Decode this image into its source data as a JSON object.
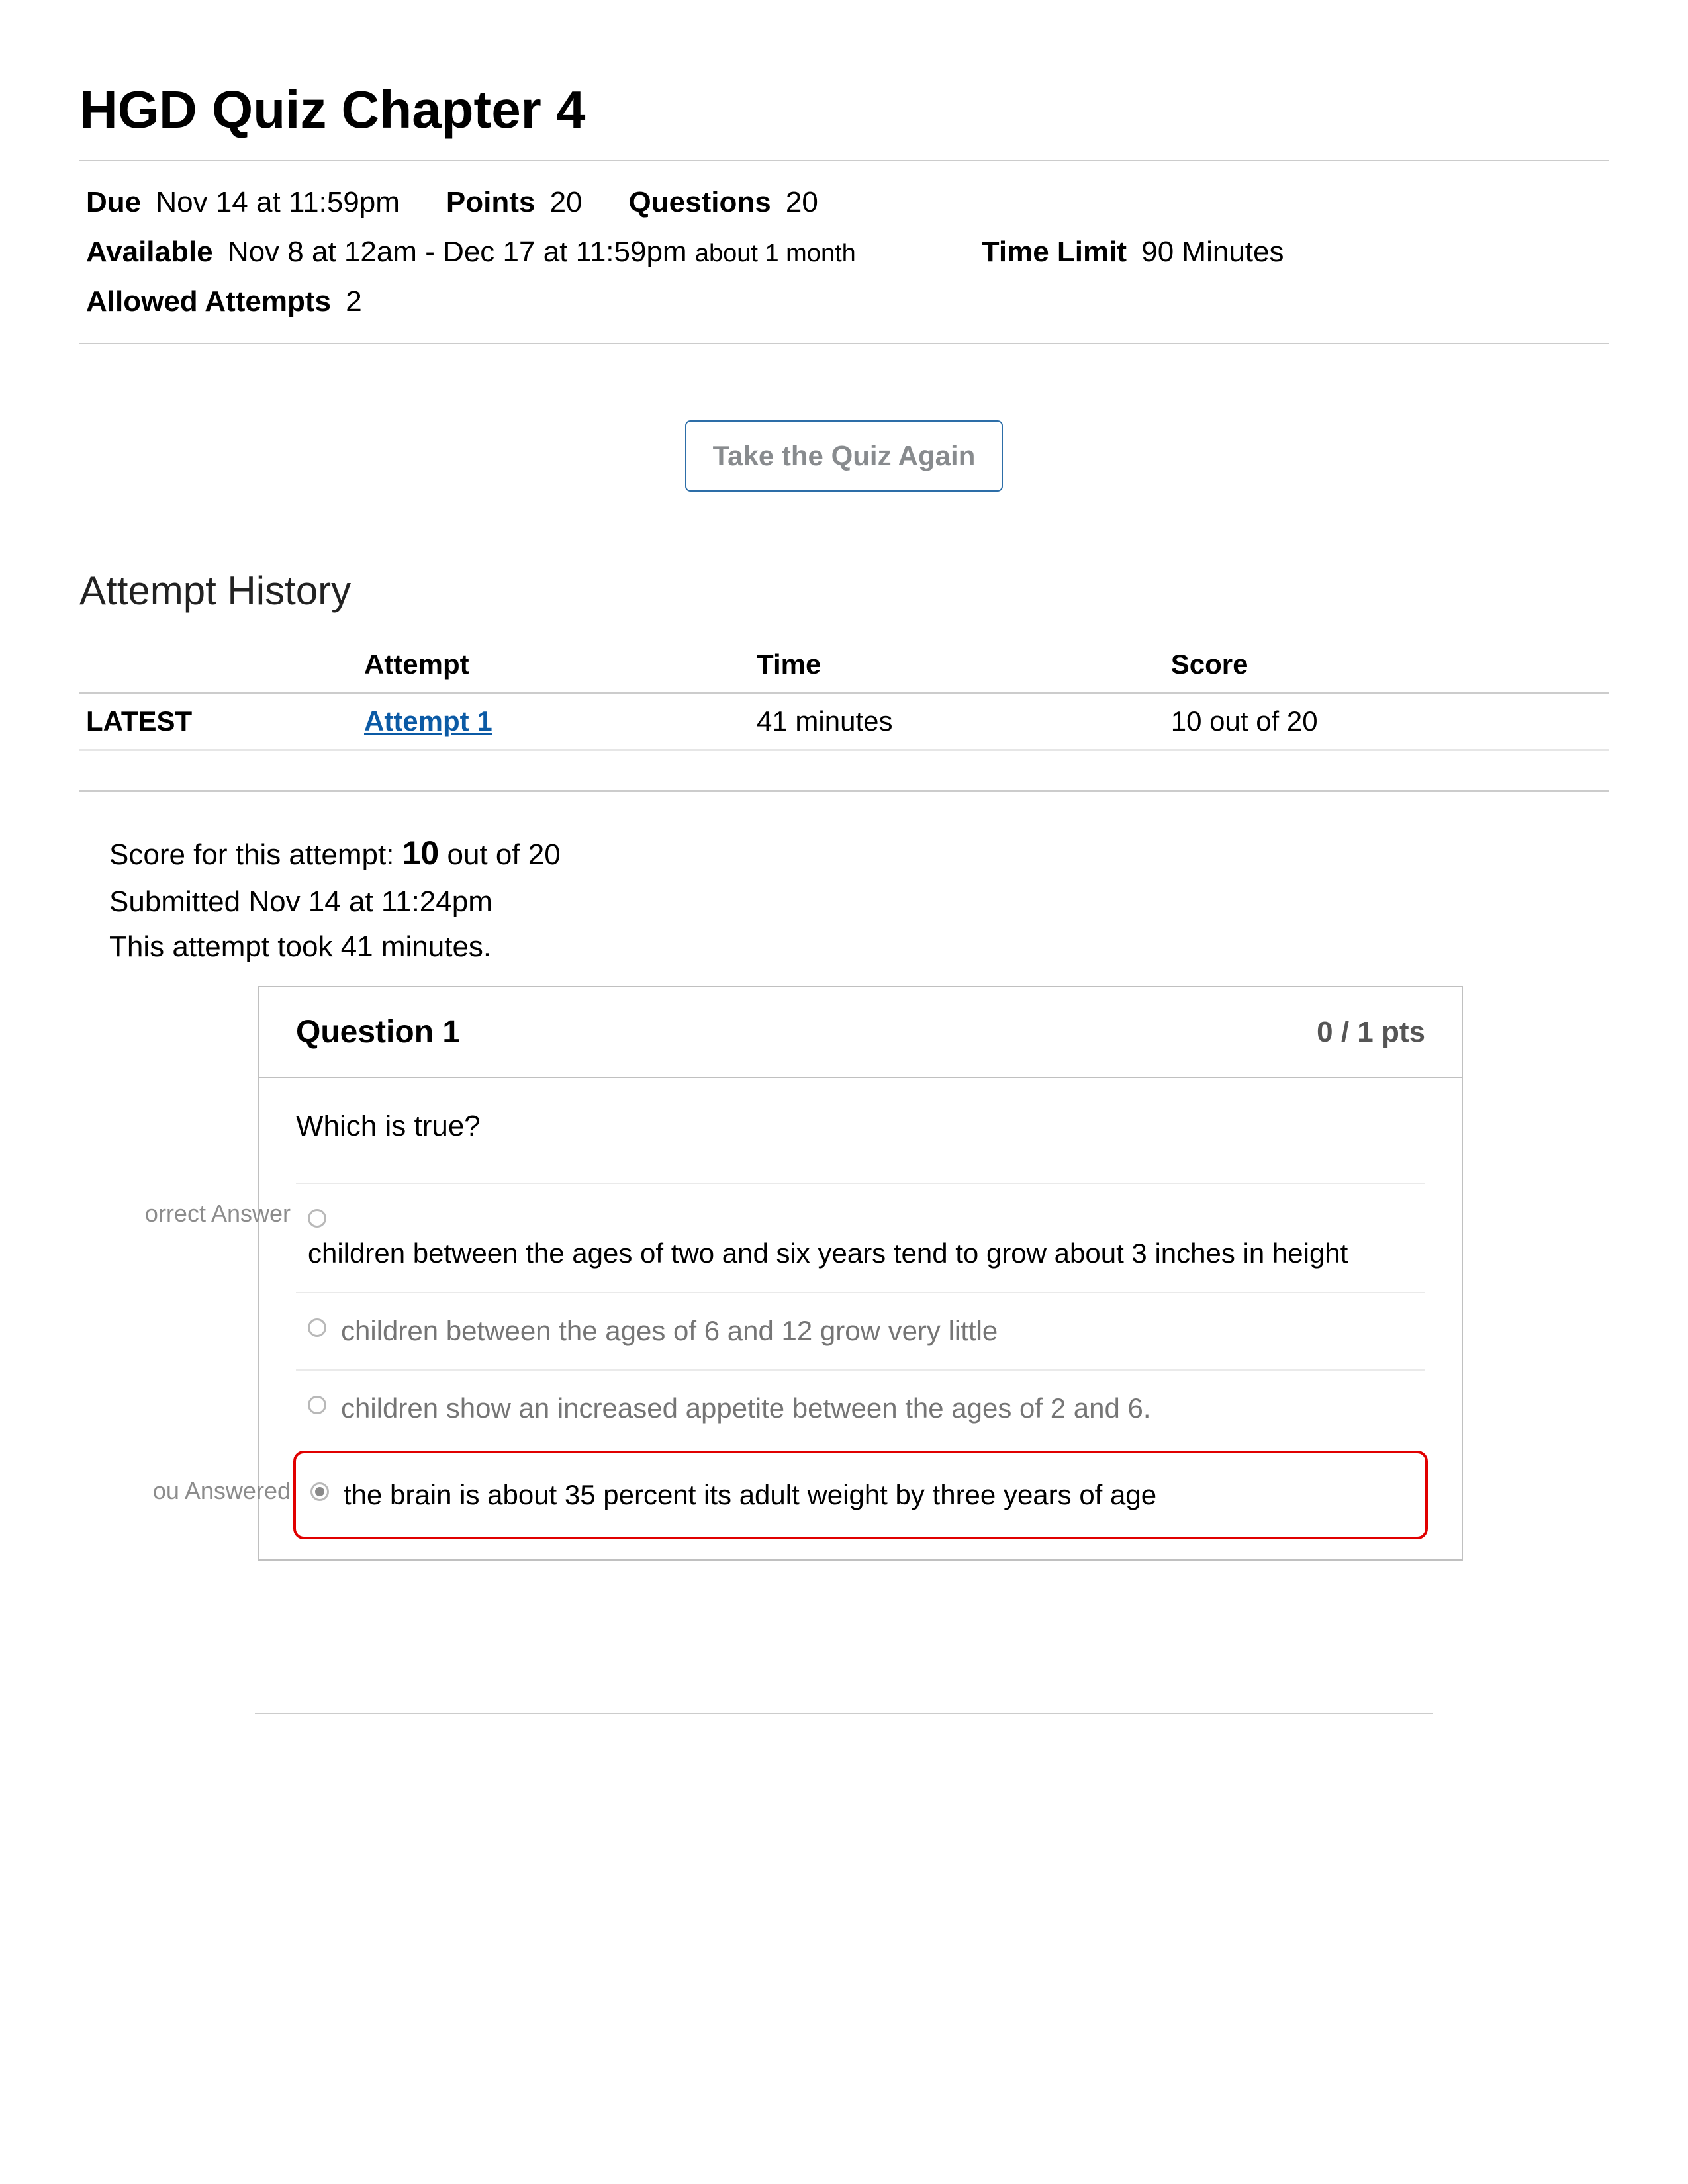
{
  "title": "HGD Quiz Chapter 4",
  "meta": {
    "due_label": "Due",
    "due_value": "Nov 14 at 11:59pm",
    "points_label": "Points",
    "points_value": "20",
    "questions_label": "Questions",
    "questions_value": "20",
    "available_label": "Available",
    "available_value": "Nov 8 at 12am - Dec 17 at 11:59pm",
    "available_note": "about 1 month",
    "time_limit_label": "Time Limit",
    "time_limit_value": "90 Minutes",
    "allowed_attempts_label": "Allowed Attempts",
    "allowed_attempts_value": "2"
  },
  "cta_label": "Take the Quiz Again",
  "history": {
    "heading": "Attempt History",
    "cols": {
      "attempt": "Attempt",
      "time": "Time",
      "score": "Score"
    },
    "latest_label": "LATEST",
    "rows": [
      {
        "attempt": "Attempt 1",
        "time": "41 minutes",
        "score": "10 out of 20"
      }
    ]
  },
  "summary": {
    "line1_prefix": "Score for this attempt: ",
    "line1_score": "10",
    "line1_suffix": " out of 20",
    "line2": "Submitted Nov 14 at 11:24pm",
    "line3": "This attempt took 41 minutes."
  },
  "question": {
    "label": "Question 1",
    "pts": "0 / 1 pts",
    "text": "Which is true?",
    "side_correct": "orrect Answer",
    "side_you": "ou Answered",
    "answers": [
      {
        "text": "children between the ages of two and six years tend to grow about 3 inches in height",
        "dim": false,
        "selected": false
      },
      {
        "text": "children between the ages of 6 and 12 grow very little",
        "dim": true,
        "selected": false
      },
      {
        "text": "children show an increased appetite between the ages of 2 and 6.",
        "dim": true,
        "selected": false
      },
      {
        "text": "the brain is about 35 percent its adult weight by three years of age",
        "dim": false,
        "selected": true
      }
    ]
  }
}
